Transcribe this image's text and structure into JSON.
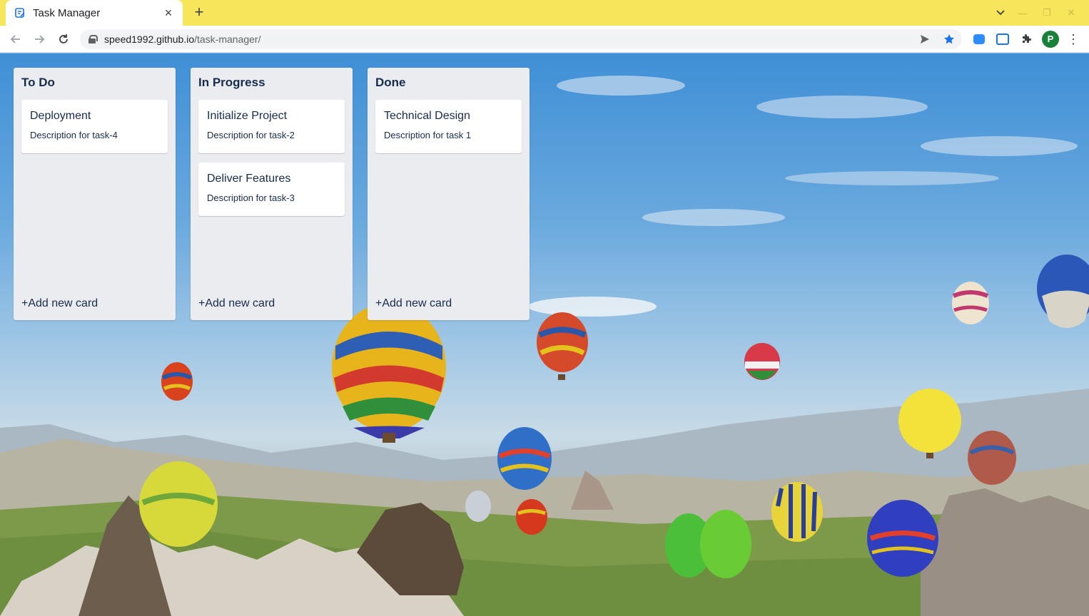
{
  "browser": {
    "tab": {
      "title": "Task Manager",
      "close_glyph": "×"
    },
    "new_tab_glyph": "+",
    "url": {
      "host": "speed1992.github.io",
      "path": "/task-manager/"
    },
    "profile_initial": "P",
    "colors": {
      "tabstrip": "#f7e65c",
      "profile": "#188038",
      "bookmark_star": "#1a73e8"
    }
  },
  "board": {
    "add_card_label": "+Add new card",
    "columns": [
      {
        "title": "To Do",
        "cards": [
          {
            "title": "Deployment",
            "description": "Description for task-4"
          }
        ]
      },
      {
        "title": "In Progress",
        "cards": [
          {
            "title": "Initialize Project",
            "description": "Description for task-2"
          },
          {
            "title": "Deliver Features",
            "description": "Description for task-3"
          }
        ]
      },
      {
        "title": "Done",
        "cards": [
          {
            "title": "Technical Design",
            "description": "Description for task 1"
          }
        ]
      }
    ],
    "colors": {
      "column_bg": "#ebecf0",
      "card_bg": "#ffffff",
      "text": "#172b4d"
    }
  }
}
